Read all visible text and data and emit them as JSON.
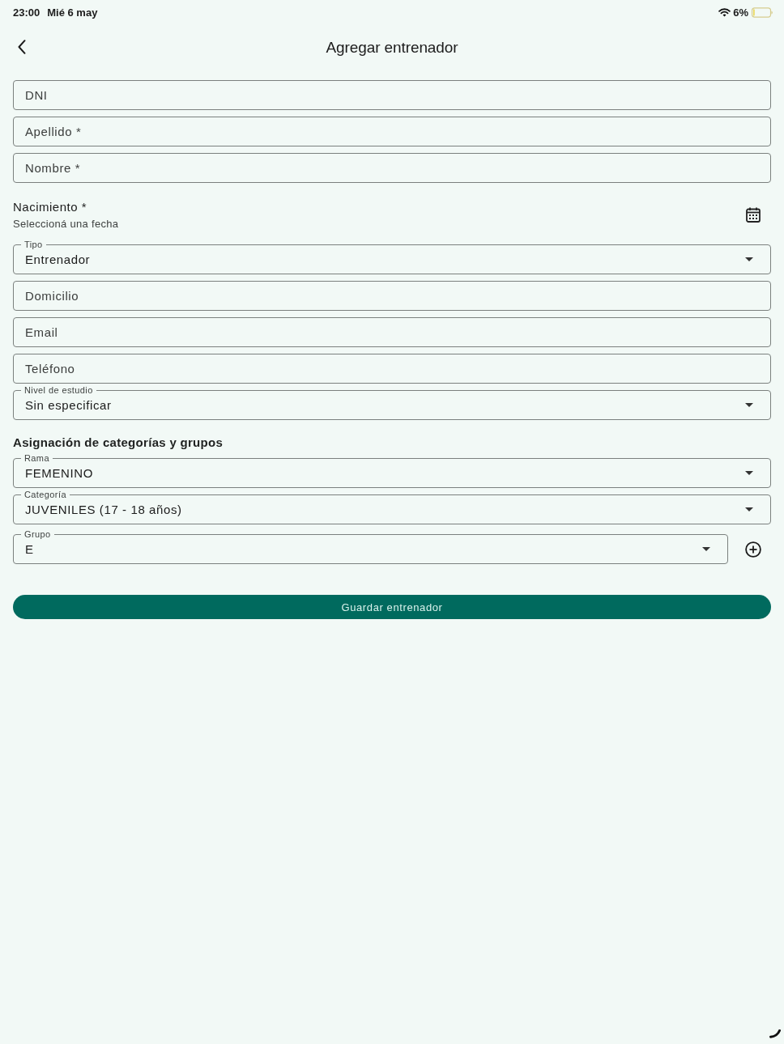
{
  "status_bar": {
    "time": "23:00",
    "date": "Mié 6 may",
    "battery": "6%"
  },
  "app_bar": {
    "title": "Agregar entrenador"
  },
  "fields": [
    {
      "kind": "text",
      "placeholder": "DNI"
    },
    {
      "kind": "text",
      "placeholder": "Apellido *"
    },
    {
      "kind": "text",
      "placeholder": "Nombre *"
    },
    {
      "kind": "date",
      "label": "Nacimiento *",
      "hint": "Seleccioná una fecha"
    },
    {
      "kind": "select",
      "label": "Tipo",
      "value": "Entrenador"
    },
    {
      "kind": "text",
      "placeholder": "Domicilio"
    },
    {
      "kind": "text",
      "placeholder": "Email"
    },
    {
      "kind": "text",
      "placeholder": "Teléfono"
    },
    {
      "kind": "select",
      "label": "Nivel de estudio",
      "value": "Sin especificar"
    }
  ],
  "assignment": {
    "title": "Asignación de categorías y grupos",
    "fields": [
      {
        "kind": "select",
        "label": "Rama",
        "value": "FEMENINO",
        "add_button": false
      },
      {
        "kind": "select",
        "label": "Categoría",
        "value": "JUVENILES (17 - 18 años)",
        "add_button": false
      },
      {
        "kind": "select",
        "label": "Grupo",
        "value": "E",
        "add_button": true
      }
    ]
  },
  "save_button": {
    "label": "Guardar entrenador"
  }
}
